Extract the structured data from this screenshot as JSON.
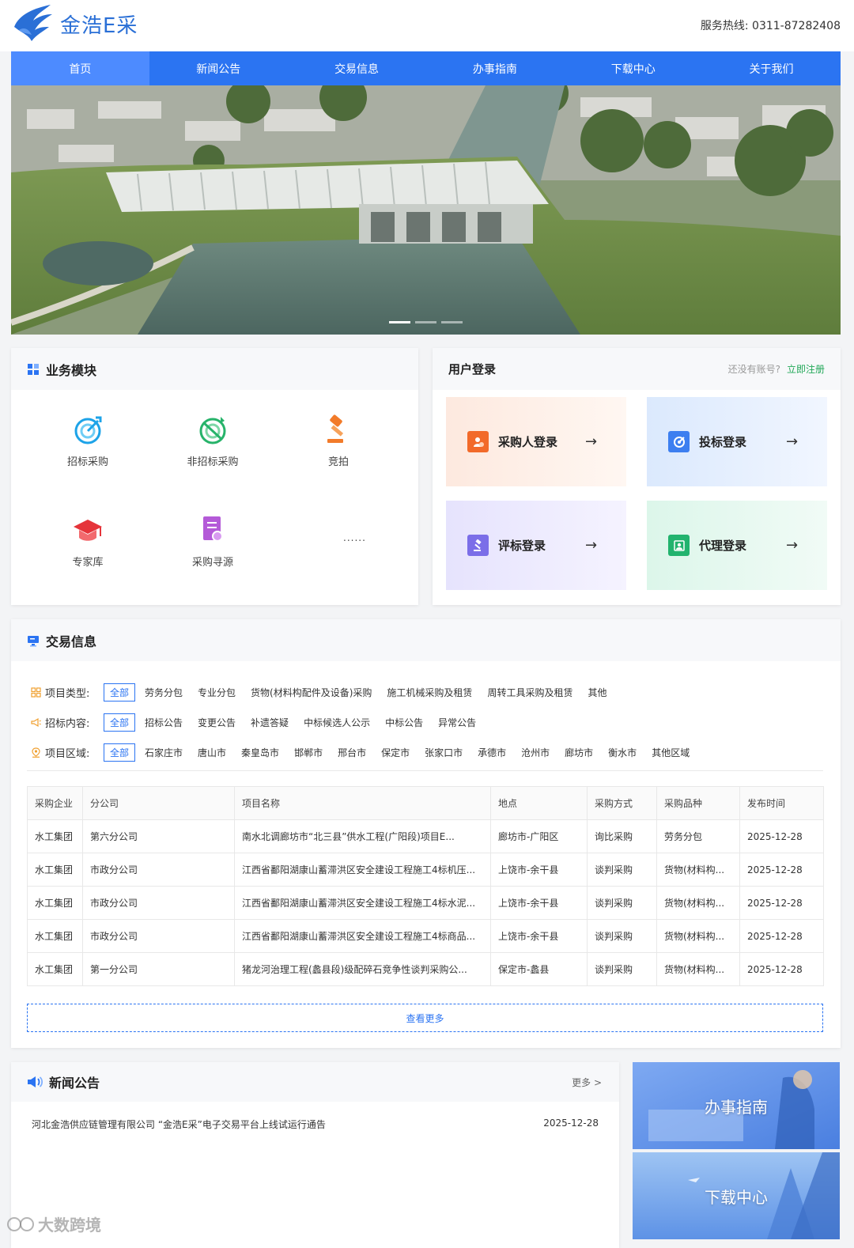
{
  "header": {
    "logo_text": "金浩E采",
    "hotline_label": "服务热线:",
    "hotline_number": "0311-87282408"
  },
  "nav": [
    "首页",
    "新闻公告",
    "交易信息",
    "办事指南",
    "下载中心",
    "关于我们"
  ],
  "business": {
    "title": "业务模块",
    "items": [
      "招标采购",
      "非招标采购",
      "竞拍",
      "专家库",
      "采购寻源"
    ],
    "more": "......"
  },
  "login": {
    "title": "用户登录",
    "no_account": "还没有账号?",
    "register": "立即注册",
    "tiles": [
      "采购人登录",
      "投标登录",
      "评标登录",
      "代理登录"
    ],
    "arrow": "→"
  },
  "trade": {
    "title": "交易信息",
    "filters": {
      "type_label": "项目类型:",
      "type_options": [
        "全部",
        "劳务分包",
        "专业分包",
        "货物(材料构配件及设备)采购",
        "施工机械采购及租赁",
        "周转工具采购及租赁",
        "其他"
      ],
      "content_label": "招标内容:",
      "content_options": [
        "全部",
        "招标公告",
        "变更公告",
        "补遗答疑",
        "中标候选人公示",
        "中标公告",
        "异常公告"
      ],
      "region_label": "项目区域:",
      "region_options": [
        "全部",
        "石家庄市",
        "唐山市",
        "秦皇岛市",
        "邯郸市",
        "邢台市",
        "保定市",
        "张家口市",
        "承德市",
        "沧州市",
        "廊坊市",
        "衡水市",
        "其他区域"
      ]
    },
    "columns": [
      "采购企业",
      "分公司",
      "项目名称",
      "地点",
      "采购方式",
      "采购品种",
      "发布时间"
    ],
    "rows": [
      [
        "水工集团",
        "第六分公司",
        "南水北调廊坊市“北三县”供水工程(广阳段)项目E...",
        "廊坊市-广阳区",
        "询比采购",
        "劳务分包",
        "2025-12-28"
      ],
      [
        "水工集团",
        "市政分公司",
        "江西省鄱阳湖康山蓄滞洪区安全建设工程施工4标机压...",
        "上饶市-余干县",
        "谈判采购",
        "货物(材料构...",
        "2025-12-28"
      ],
      [
        "水工集团",
        "市政分公司",
        "江西省鄱阳湖康山蓄滞洪区安全建设工程施工4标水泥...",
        "上饶市-余干县",
        "谈判采购",
        "货物(材料构...",
        "2025-12-28"
      ],
      [
        "水工集团",
        "市政分公司",
        "江西省鄱阳湖康山蓄滞洪区安全建设工程施工4标商品...",
        "上饶市-余干县",
        "谈判采购",
        "货物(材料构...",
        "2025-12-28"
      ],
      [
        "水工集团",
        "第一分公司",
        "猪龙河治理工程(蠡县段)级配碎石竞争性谈判采购公...",
        "保定市-蠡县",
        "谈判采购",
        "货物(材料构...",
        "2025-12-28"
      ]
    ],
    "more": "查看更多"
  },
  "news": {
    "title": "新闻公告",
    "more": "更多 >",
    "items": [
      {
        "title": "河北金浩供应链管理有限公司 “金浩E采”电子交易平台上线试运行通告",
        "date": "2025-12-28"
      }
    ]
  },
  "side": {
    "guide": "办事指南",
    "download": "下载中心"
  },
  "watermark": "大数跨境",
  "colors": {
    "primary": "#2b74f2",
    "register": "#22a858"
  }
}
